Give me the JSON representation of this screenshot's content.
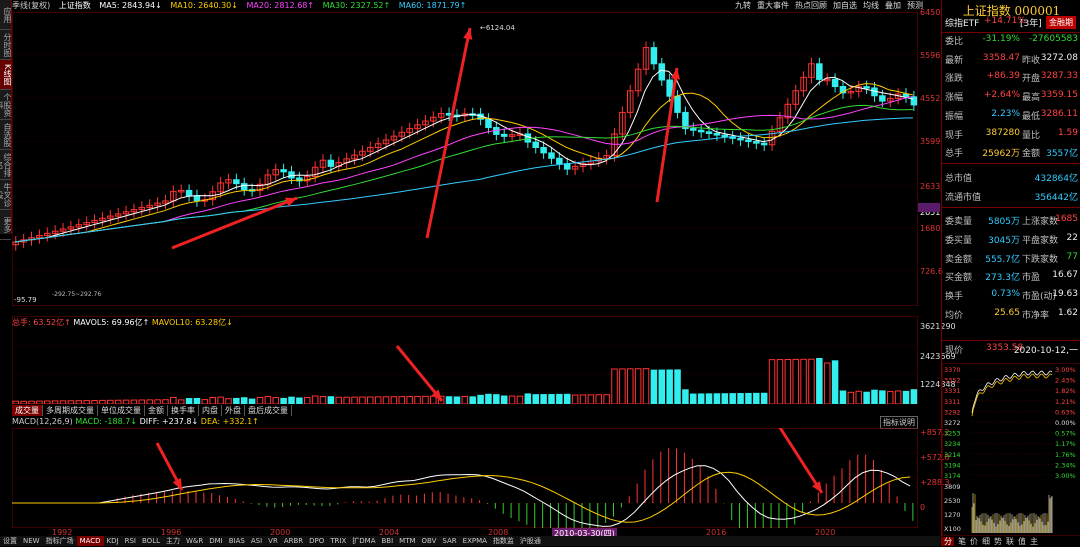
{
  "sidebar": {
    "items": [
      {
        "label": "应用",
        "active": false
      },
      {
        "label": "分时图",
        "active": false
      },
      {
        "label": "K线图",
        "active": true
      },
      {
        "label": "个股资料",
        "active": false
      },
      {
        "label": "自选股",
        "active": false
      },
      {
        "label": "综合排名",
        "active": false
      },
      {
        "label": "牛叉诊股",
        "active": false
      },
      {
        "label": "更多",
        "active": false
      }
    ]
  },
  "topbar": {
    "period": "季线(复权)",
    "name": "上证指数",
    "ma5": "MA5: 2843.94↓",
    "ma10": "MA10: 2640.30↓",
    "ma20": "MA20: 2812.68↑",
    "ma30": "MA30: 2327.52↑",
    "ma60": "MA60: 1871.79↑"
  },
  "toolbar": [
    "九转",
    "重大事件",
    "热点回顾",
    "加自选",
    "均线",
    "叠加",
    "预测"
  ],
  "main_axis": [
    "6450",
    "5596",
    "4552",
    "3599",
    "2633",
    "2051",
    "1680",
    "726.6"
  ],
  "main_annotations": {
    "high_label": "6124.04",
    "low_label": "-95.79",
    "low2_label": "-292.75~292.76"
  },
  "volume": {
    "legend": {
      "v1": "总手: 63.52亿↑",
      "v2": "MAVOL5: 69.96亿↑",
      "v3": "MAVOL10: 63.28亿↓"
    },
    "axis": [
      "3621290",
      "2423669",
      "1224848"
    ],
    "tabs": [
      {
        "label": "成交量",
        "active": true
      },
      {
        "label": "多周期成交量",
        "active": false
      },
      {
        "label": "单位成交量",
        "active": false
      },
      {
        "label": "金额",
        "active": false
      },
      {
        "label": "换手率",
        "active": false
      },
      {
        "label": "内盘",
        "active": false
      },
      {
        "label": "外盘",
        "active": false
      },
      {
        "label": "盘后成交量",
        "active": false
      }
    ]
  },
  "macd": {
    "legend": {
      "label": "MACD(12,26,9)",
      "macd": "MACD: -188.7↓",
      "diff": "DIFF: +237.8↓",
      "dea": "DEA: +332.1↑"
    },
    "help": "指标说明",
    "axis": [
      "+857.2",
      "+572.8",
      "+288.3",
      "0"
    ]
  },
  "xaxis": {
    "labels": [
      "1992",
      "1996",
      "2000",
      "2004",
      "2008",
      "2012",
      "2016",
      "2020"
    ],
    "cursor_label": "2010-03-30(四)"
  },
  "bottom_tabs": [
    {
      "label": "设置",
      "active": false
    },
    {
      "label": "NEW",
      "active": false
    },
    {
      "label": "指标广场",
      "active": false
    },
    {
      "label": "MACD",
      "active": true
    },
    {
      "label": "KDJ",
      "active": false
    },
    {
      "label": "RSI",
      "active": false
    },
    {
      "label": "BOLL",
      "active": false
    },
    {
      "label": "主力",
      "active": false
    },
    {
      "label": "W&R",
      "active": false
    },
    {
      "label": "DMI",
      "active": false
    },
    {
      "label": "BIAS",
      "active": false
    },
    {
      "label": "ASI",
      "active": false
    },
    {
      "label": "VR",
      "active": false
    },
    {
      "label": "ARBR",
      "active": false
    },
    {
      "label": "DPO",
      "active": false
    },
    {
      "label": "TRIX",
      "active": false
    },
    {
      "label": "扩DMA",
      "active": false
    },
    {
      "label": "BBI",
      "active": false
    },
    {
      "label": "MTM",
      "active": false
    },
    {
      "label": "OBV",
      "active": false
    },
    {
      "label": "SAR",
      "active": false
    },
    {
      "label": "EXPMA",
      "active": false
    },
    {
      "label": "指数监",
      "active": false
    },
    {
      "label": "沪股通",
      "active": false
    }
  ],
  "right_panel": {
    "title": "上证指数 000001",
    "etf_label": "综指ETF",
    "etf_change": "+14.71%",
    "etf_period": "[3年]",
    "badge": "金融期",
    "rows": [
      {
        "l1": "委比",
        "v1": "-31.19%",
        "l2": "",
        "v2": "-27605583",
        "c1": "green",
        "c2": "green"
      },
      {
        "l1": "最新",
        "v1": "3358.47",
        "l2": "昨收",
        "v2": "3272.08",
        "c1": "red",
        "c2": "white"
      },
      {
        "l1": "涨跌",
        "v1": "+86.39",
        "l2": "开盘",
        "v2": "3287.33",
        "c1": "red",
        "c2": "red"
      },
      {
        "l1": "涨幅",
        "v1": "+2.64%",
        "l2": "最高",
        "v2": "3359.15",
        "c1": "red",
        "c2": "red"
      },
      {
        "l1": "振幅",
        "v1": "2.23%",
        "l2": "最低",
        "v2": "3286.11",
        "c1": "cyan",
        "c2": "red"
      },
      {
        "l1": "现手",
        "v1": "387280",
        "l2": "量比",
        "v2": "1.59",
        "c1": "yellow",
        "c2": "red"
      },
      {
        "l1": "总手",
        "v1": "25962万",
        "l2": "金额",
        "v2": "3557亿",
        "c1": "yellow",
        "c2": "cyan"
      },
      {
        "l1": "总市值",
        "v1": "",
        "l2": "",
        "v2": "432864亿",
        "c1": "white",
        "c2": "cyan"
      },
      {
        "l1": "流通市值",
        "v1": "",
        "l2": "",
        "v2": "356442亿",
        "c1": "white",
        "c2": "cyan"
      },
      {
        "l1": "委卖量",
        "v1": "5805万",
        "l2": "上涨家数",
        "v2": "1685",
        "c1": "cyan",
        "c2": "red"
      },
      {
        "l1": "委买量",
        "v1": "3045万",
        "l2": "平盘家数",
        "v2": "22",
        "c1": "cyan",
        "c2": "white"
      },
      {
        "l1": "卖金额",
        "v1": "555.7亿",
        "l2": "下跌家数",
        "v2": "77",
        "c1": "cyan",
        "c2": "green"
      },
      {
        "l1": "买金额",
        "v1": "273.3亿",
        "l2": "市盈",
        "v2": "16.67",
        "c1": "cyan",
        "c2": "white"
      },
      {
        "l1": "换手",
        "v1": "0.73%",
        "l2": "市盈(动)",
        "v2": "19.63",
        "c1": "cyan",
        "c2": "white"
      },
      {
        "l1": "均价",
        "v1": "25.65",
        "l2": "市净率",
        "v2": "1.62",
        "c1": "yellow",
        "c2": "white"
      }
    ],
    "now_label": "现价",
    "now_value": "3353.58",
    "now_time": "2020-10-12,一",
    "mini_left": [
      "3370",
      "3352",
      "3331",
      "3311",
      "3292",
      "3272",
      "3253",
      "3234",
      "3214",
      "3194",
      "3174"
    ],
    "mini_right": [
      "3.00%",
      "2.43%",
      "1.82%",
      "1.21%",
      "0.63%",
      "0.00%",
      "0.57%",
      "1.17%",
      "1.76%",
      "2.34%",
      "3.00%"
    ],
    "mini_vol": [
      "3809",
      "2530",
      "1270",
      "X100"
    ],
    "bottom": [
      "分",
      "笔",
      "价",
      "细",
      "势",
      "联",
      "值",
      "主"
    ]
  }
}
